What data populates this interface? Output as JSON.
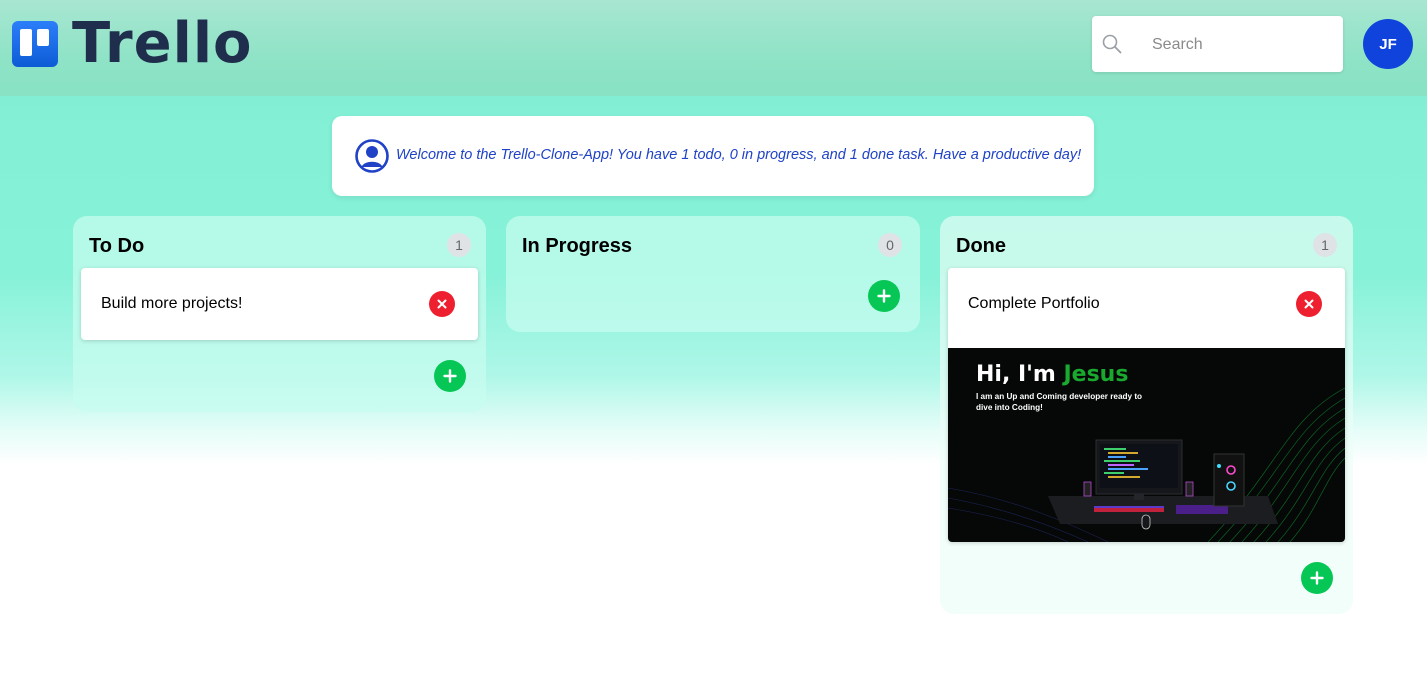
{
  "header": {
    "logo_text": "Trello",
    "search_placeholder": "Search",
    "avatar_initials": "JF"
  },
  "welcome": {
    "message": "Welcome to the Trello-Clone-App! You have 1 todo, 0 in progress, and 1 done task. Have a productive day!"
  },
  "columns": [
    {
      "title": "To Do",
      "count": "1",
      "cards": [
        {
          "title": "Build more projects!"
        }
      ]
    },
    {
      "title": "In Progress",
      "count": "0",
      "cards": []
    },
    {
      "title": "Done",
      "count": "1",
      "cards": [
        {
          "title": "Complete Portfolio",
          "image": {
            "headline_prefix": "Hi, I'm ",
            "headline_accent": "Jesus",
            "subtitle": "I am an Up and Coming developer ready to dive into Coding!"
          }
        }
      ]
    }
  ],
  "colors": {
    "brand_blue": "#0f43db",
    "add_green": "#06c755",
    "delete_red": "#ee1f2f",
    "welcome_text": "#1f42c6"
  },
  "icons": [
    "search-icon",
    "user-circle-icon",
    "close-icon",
    "plus-icon"
  ]
}
